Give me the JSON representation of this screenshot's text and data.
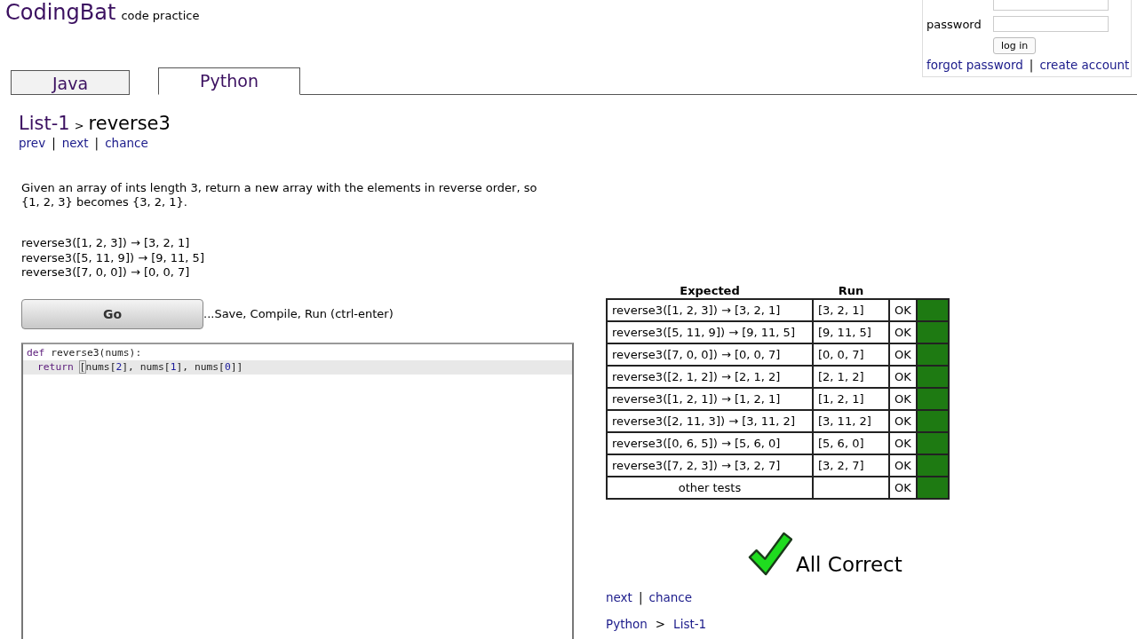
{
  "header": {
    "logo": "CodingBat",
    "tagline": "code practice"
  },
  "login": {
    "password_label": "password",
    "button": "log in",
    "links": [
      "forgot password",
      "create account"
    ],
    "separator": "|"
  },
  "tabs": [
    {
      "label": "Java",
      "selected": false
    },
    {
      "label": "Python",
      "selected": true
    }
  ],
  "breadcrumb": {
    "section": "List-1",
    "separator": ">",
    "problem": "reverse3"
  },
  "nav_links": [
    "prev",
    "next",
    "chance"
  ],
  "nav_separator": "|",
  "description": "Given an array of ints length 3, return a new array with the elements in reverse order, so {1, 2, 3} becomes {3, 2, 1}.",
  "examples": [
    "reverse3([1, 2, 3]) → [3, 2, 1]",
    "reverse3([5, 11, 9]) → [9, 11, 5]",
    "reverse3([7, 0, 0]) → [0, 0, 7]"
  ],
  "go_button": "Go",
  "go_hint": "...Save, Compile, Run (ctrl-enter)",
  "code": [
    {
      "highlighted": false,
      "tokens": [
        {
          "kind": "keyword",
          "text": "def"
        },
        {
          "kind": "plain",
          "text": " reverse3(nums):"
        }
      ]
    },
    {
      "highlighted": true,
      "indented": true,
      "tokens": [
        {
          "kind": "keyword",
          "text": "return "
        },
        {
          "kind": "bracket",
          "text": "["
        },
        {
          "kind": "plain",
          "text": "nums["
        },
        {
          "kind": "number",
          "text": "2"
        },
        {
          "kind": "plain",
          "text": "], nums["
        },
        {
          "kind": "number",
          "text": "1"
        },
        {
          "kind": "plain",
          "text": "], nums["
        },
        {
          "kind": "number",
          "text": "0"
        },
        {
          "kind": "plain",
          "text": "]]"
        }
      ]
    }
  ],
  "results": {
    "columns": [
      "Expected",
      "Run"
    ],
    "rows": [
      {
        "expected": "reverse3([1, 2, 3]) → [3, 2, 1]",
        "run": "[3, 2, 1]",
        "status": "OK",
        "passed": true
      },
      {
        "expected": "reverse3([5, 11, 9]) → [9, 11, 5]",
        "run": "[9, 11, 5]",
        "status": "OK",
        "passed": true
      },
      {
        "expected": "reverse3([7, 0, 0]) → [0, 0, 7]",
        "run": "[0, 0, 7]",
        "status": "OK",
        "passed": true
      },
      {
        "expected": "reverse3([2, 1, 2]) → [2, 1, 2]",
        "run": "[2, 1, 2]",
        "status": "OK",
        "passed": true
      },
      {
        "expected": "reverse3([1, 2, 1]) → [1, 2, 1]",
        "run": "[1, 2, 1]",
        "status": "OK",
        "passed": true
      },
      {
        "expected": "reverse3([2, 11, 3]) → [3, 11, 2]",
        "run": "[3, 11, 2]",
        "status": "OK",
        "passed": true
      },
      {
        "expected": "reverse3([0, 6, 5]) → [5, 6, 0]",
        "run": "[5, 6, 0]",
        "status": "OK",
        "passed": true
      },
      {
        "expected": "reverse3([7, 2, 3]) → [3, 2, 7]",
        "run": "[3, 2, 7]",
        "status": "OK",
        "passed": true
      },
      {
        "expected": "other tests",
        "status": "OK",
        "passed": true
      }
    ],
    "message": "All Correct"
  },
  "bottom_links": [
    "next",
    "chance"
  ],
  "bottom_separator": "|",
  "bottom_breadcrumb": [
    "Python",
    ">",
    "List-1"
  ]
}
